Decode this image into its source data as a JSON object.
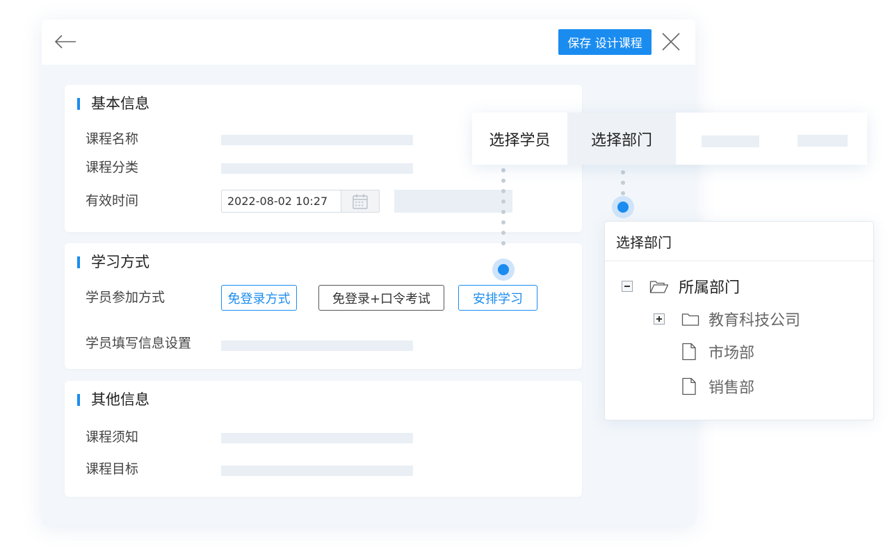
{
  "toolbar": {
    "save_label": "保存 设计课程"
  },
  "sections": {
    "basic": {
      "title": "基本信息",
      "course_name_label": "课程名称",
      "course_category_label": "课程分类",
      "valid_time_label": "有效时间",
      "valid_time_value": "2022-08-02 10:27"
    },
    "learning": {
      "title": "学习方式",
      "join_method_label": "学员参加方式",
      "options": [
        "免登录方式",
        "免登录+口令考试",
        "安排学习"
      ],
      "info_settings_label": "学员填写信息设置"
    },
    "other": {
      "title": "其他信息",
      "notice_label": "课程须知",
      "goal_label": "课程目标"
    }
  },
  "selector": {
    "tabs": [
      "选择学员",
      "选择部门"
    ],
    "active_tab": "选择部门"
  },
  "dept_panel": {
    "title": "选择部门",
    "tree": {
      "root": "所属部门",
      "children": [
        "教育科技公司",
        "市场部",
        "销售部"
      ]
    }
  },
  "colors": {
    "accent": "#1a8cf0",
    "background": "#f3f7fb",
    "placeholder": "#e9eff5"
  },
  "icons": [
    "back-arrow-icon",
    "close-icon",
    "calendar-icon",
    "folder-open-icon",
    "folder-icon",
    "file-icon",
    "collapse-icon",
    "expand-icon"
  ]
}
